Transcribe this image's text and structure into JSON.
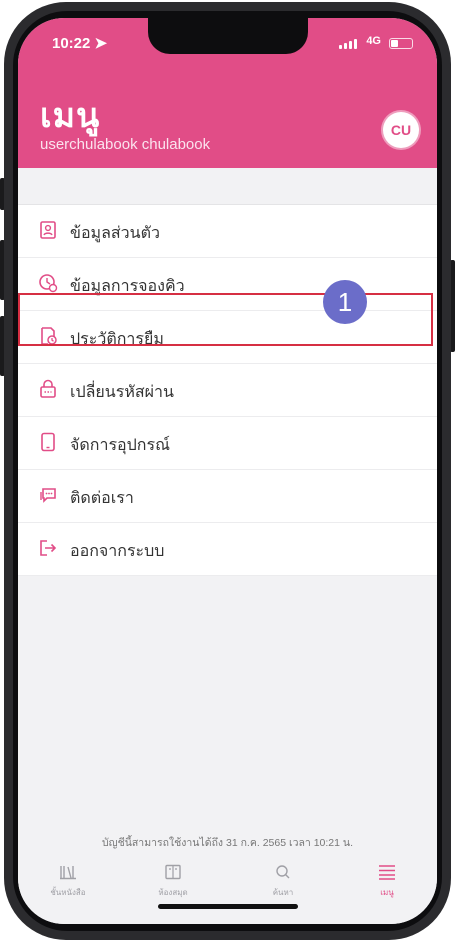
{
  "status_bar": {
    "time": "10:22",
    "network": "4G",
    "battery_level": 0.3
  },
  "header": {
    "title": "เมนู",
    "username": "userchulabook chulabook",
    "logo_text": "CU"
  },
  "menu": {
    "items": [
      {
        "label": "ข้อมูลส่วนตัว",
        "icon": "profile-card-icon"
      },
      {
        "label": "ข้อมูลการจองคิว",
        "icon": "queue-clock-icon"
      },
      {
        "label": "ประวัติการยืม",
        "icon": "borrow-history-icon"
      },
      {
        "label": "เปลี่ยนรหัสผ่าน",
        "icon": "lock-icon"
      },
      {
        "label": "จัดการอุปกรณ์",
        "icon": "device-icon"
      },
      {
        "label": "ติดต่อเรา",
        "icon": "chat-icon"
      },
      {
        "label": "ออกจากระบบ",
        "icon": "logout-icon"
      }
    ],
    "highlighted_index": 2
  },
  "annotation": {
    "step": "1",
    "marker_color": "#6b6dc9",
    "box_color": "#d62f43"
  },
  "footer_note": "บัญชีนี้สามารถใช้งานได้ถึง 31 ก.ค. 2565 เวลา 10:21 น.",
  "tabs": [
    {
      "label": "ชั้นหนังสือ",
      "icon": "bookshelf-icon"
    },
    {
      "label": "ห้องสมุด",
      "icon": "library-icon"
    },
    {
      "label": "ค้นหา",
      "icon": "search-icon"
    },
    {
      "label": "เมนู",
      "icon": "menu-icon",
      "active": true
    }
  ],
  "colors": {
    "brand": "#e14d87",
    "background": "#f2f2f4"
  }
}
